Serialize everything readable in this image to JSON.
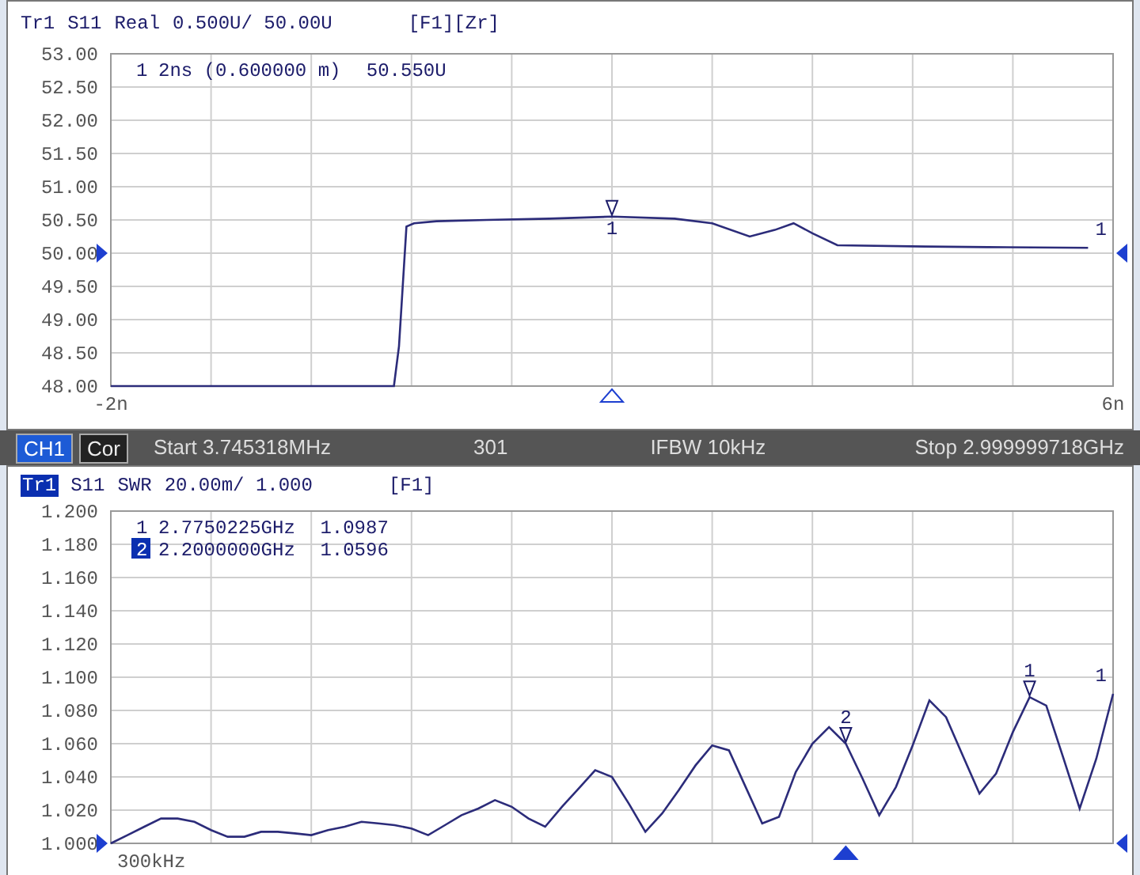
{
  "panels": [
    {
      "title": {
        "trace": "Tr1",
        "trace_active": false,
        "parameter": "S11",
        "format": "Real",
        "scale": "0.500U/ 50.00U",
        "flags": "[F1][Zr]"
      },
      "marker_readouts": [
        {
          "number": "1",
          "stimulus": "2ns (0.600000 m)",
          "value": "50.550U",
          "active": false
        }
      ],
      "trace_number": "1",
      "chart_data": {
        "type": "line",
        "grid": true,
        "xlim": [
          -2,
          6
        ],
        "ylim": [
          48,
          53
        ],
        "xticks": [
          {
            "value": -2,
            "label": "-2n"
          },
          {
            "value": 6,
            "label": "6n"
          }
        ],
        "yticks": [
          {
            "value": 48,
            "label": "48.00"
          },
          {
            "value": 48.5,
            "label": "48.50"
          },
          {
            "value": 49,
            "label": "49.00"
          },
          {
            "value": 49.5,
            "label": "49.50"
          },
          {
            "value": 50,
            "label": "50.00"
          },
          {
            "value": 50.5,
            "label": "50.50"
          },
          {
            "value": 51,
            "label": "51.00"
          },
          {
            "value": 51.5,
            "label": "51.50"
          },
          {
            "value": 52,
            "label": "52.00"
          },
          {
            "value": 52.5,
            "label": "52.50"
          },
          {
            "value": 53,
            "label": "53.00"
          }
        ],
        "x": [
          -2,
          0.26,
          0.3,
          0.36,
          0.42,
          0.6,
          1.0,
          1.5,
          2.0,
          2.5,
          2.8,
          3.1,
          3.3,
          3.45,
          3.6,
          3.8,
          4.5,
          5.0,
          5.8
        ],
        "series": [
          {
            "color": "#2c2c7a",
            "values": [
              48,
              48,
              48.6,
              50.4,
              50.45,
              50.48,
              50.5,
              50.52,
              50.55,
              50.52,
              50.45,
              50.25,
              50.35,
              50.45,
              50.3,
              50.12,
              50.1,
              50.09,
              50.08
            ]
          }
        ],
        "annotations": [
          {
            "x": 2,
            "y": 50.55,
            "text": "1"
          }
        ]
      }
    },
    {
      "title": {
        "trace": "Tr1",
        "trace_active": true,
        "parameter": "S11",
        "format": "SWR",
        "scale": "20.00m/ 1.000",
        "flags": "[F1]"
      },
      "marker_readouts": [
        {
          "number": "1",
          "stimulus": "2.7750225GHz",
          "value": "1.0987",
          "active": false
        },
        {
          "number": "2",
          "stimulus": "2.2000000GHz",
          "value": "1.0596",
          "active": true
        }
      ],
      "trace_number": "1",
      "chart_data": {
        "type": "line",
        "grid": true,
        "ylim": [
          1,
          1.2
        ],
        "yticks": [
          {
            "value": 1,
            "label": "1.000"
          },
          {
            "value": 1.02,
            "label": "1.020"
          },
          {
            "value": 1.04,
            "label": "1.040"
          },
          {
            "value": 1.06,
            "label": "1.060"
          },
          {
            "value": 1.08,
            "label": "1.080"
          },
          {
            "value": 1.1,
            "label": "1.100"
          },
          {
            "value": 1.12,
            "label": "1.120"
          },
          {
            "value": 1.14,
            "label": "1.140"
          },
          {
            "value": 1.16,
            "label": "1.160"
          },
          {
            "value": 1.18,
            "label": "1.180"
          },
          {
            "value": 1.2,
            "label": "1.200"
          }
        ],
        "series": [
          {
            "color": "#2c2c7a",
            "values": [
              1.0,
              1.005,
              1.01,
              1.015,
              1.015,
              1.013,
              1.008,
              1.004,
              1.004,
              1.007,
              1.007,
              1.006,
              1.005,
              1.008,
              1.01,
              1.013,
              1.012,
              1.011,
              1.009,
              1.005,
              1.011,
              1.017,
              1.021,
              1.026,
              1.022,
              1.015,
              1.01,
              1.022,
              1.033,
              1.044,
              1.04,
              1.024,
              1.007,
              1.018,
              1.032,
              1.047,
              1.059,
              1.056,
              1.034,
              1.012,
              1.016,
              1.043,
              1.06,
              1.07,
              1.06,
              1.039,
              1.017,
              1.034,
              1.059,
              1.086,
              1.076,
              1.053,
              1.03,
              1.042,
              1.067,
              1.088,
              1.083,
              1.052,
              1.021,
              1.051,
              1.09
            ]
          }
        ],
        "annotations": [
          {
            "text": "1"
          },
          {
            "text": "2"
          }
        ]
      },
      "x_start_label": "300kHz"
    }
  ],
  "status_bar": {
    "channel": "CH1",
    "channel_active": true,
    "correction": "Cor",
    "start": "Start 3.745318MHz",
    "points": "301",
    "ifbw": "IFBW 10kHz",
    "stop": "Stop 2.999999718GHz"
  }
}
